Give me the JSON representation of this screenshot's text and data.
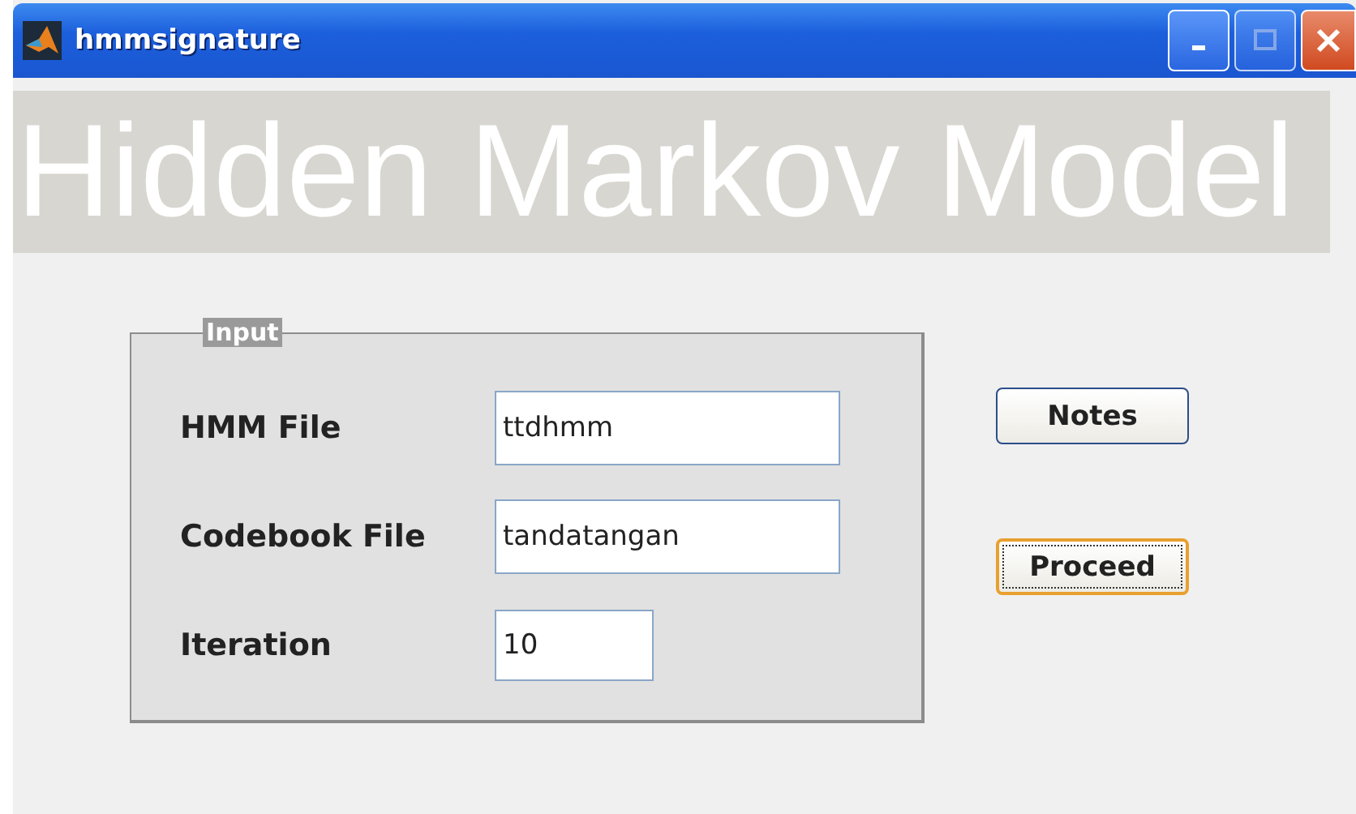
{
  "window": {
    "title": "hmmsignature"
  },
  "banner": {
    "text": "Hidden Markov Model"
  },
  "input_group": {
    "title": "Input",
    "fields": [
      {
        "label": "HMM File",
        "value": "ttdhmm",
        "kind": "wide"
      },
      {
        "label": "Codebook File",
        "value": "tandatangan",
        "kind": "wide"
      },
      {
        "label": "Iteration",
        "value": "10",
        "kind": "narrow"
      }
    ]
  },
  "buttons": [
    {
      "label": "Notes",
      "focused": false
    },
    {
      "label": "Proceed",
      "focused": true
    }
  ]
}
